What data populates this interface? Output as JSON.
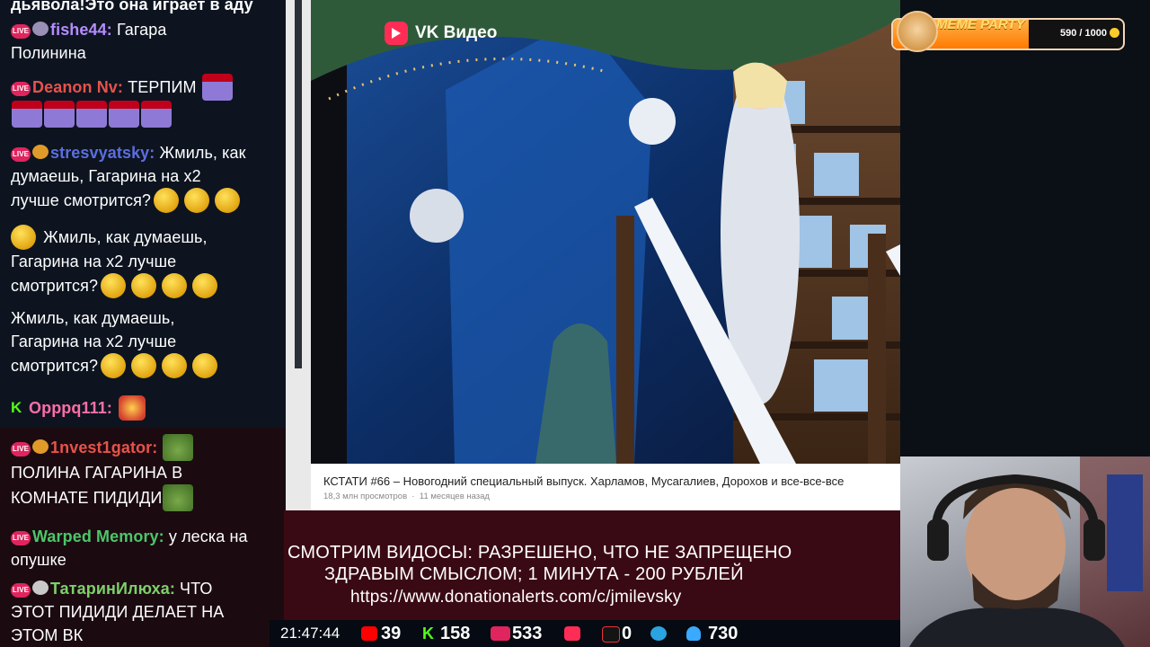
{
  "chat": {
    "top_text": "дьявола!Это она играет в аду",
    "messages": [
      {
        "platform": "live",
        "nick": "fishe44:",
        "nick_color": "#b58cff",
        "text_l1": "Гагара",
        "text_l2": "Полинина"
      },
      {
        "platform": "live",
        "nick": "Deanon Nv:",
        "nick_color": "#e8524b",
        "text_l1": "ТЕРПИМ"
      },
      {
        "platform": "live",
        "nick": "stresvyatsky:",
        "nick_color": "#5b6ee0",
        "text_l1": "Жмиль, как",
        "text_l2": "думаешь, Гагарина на х2",
        "text_l3": "лучше смотрится?"
      },
      {
        "text_l1": "Жмиль, как думаешь,",
        "text_l2": "Гагарина на х2 лучше",
        "text_l3": "смотрится?"
      },
      {
        "text_l1": "Жмиль, как думаешь,",
        "text_l2": "Гагарина на х2 лучше",
        "text_l3": "смотрится?"
      },
      {
        "platform": "kick",
        "nick": "Opppq111:",
        "nick_color": "#ff6ea8"
      },
      {
        "platform": "live",
        "nick": "1nvest1gator:",
        "nick_color": "#e8524b",
        "text_l1": "ПОЛИНА ГАГАРИНА В",
        "text_l2": "КОМНАТЕ ПИДИДИ"
      },
      {
        "platform": "live",
        "nick": "Warped Memory:",
        "nick_color": "#4cc66a",
        "text_l1": "у леска на",
        "text_l2": "опушке"
      },
      {
        "platform": "live",
        "nick": "ТатаринИлюха:",
        "nick_color": "#7ed06b",
        "text_l1": "ЧТО",
        "text_l2": "ЭТОТ ПИДИДИ ДЕЛАЕТ НА",
        "text_l3": "ЭТОМ ВК"
      }
    ],
    "live_badge": "LIVE"
  },
  "video": {
    "brand": "VK Видео",
    "title": "КСТАТИ #66 – Новогодний специальный выпуск. Харламов, Мусагалиев, Дорохов и все-все-все",
    "views": "18,3 млн просмотров",
    "age": "11 месяцев назад"
  },
  "banner": {
    "line1": "СМОТРИМ ВИДОСЫ: РАЗРЕШЕНО, ЧТО НЕ ЗАПРЕЩЕНО",
    "line2": "ЗДРАВЫМ СМЫСЛОМ; 1 МИНУТА - 200 РУБЛЕЙ",
    "line3": "https://www.donationalerts.com/c/jmilevsky"
  },
  "statusbar": {
    "time": "21:47:44",
    "youtube": "39",
    "kick": "158",
    "vklive": "533",
    "vkvideo_live": "",
    "rutube": "0",
    "telegram": "",
    "viewers": "730"
  },
  "meme_party": {
    "label": "MEME PARTY",
    "count": "590 / 1000",
    "progress": 0.59
  },
  "colors": {
    "accent_live": "#e0245e",
    "kick": "#53fc18",
    "banner_bg": "#3a0a14",
    "meme_fill": "#ff8a00"
  }
}
